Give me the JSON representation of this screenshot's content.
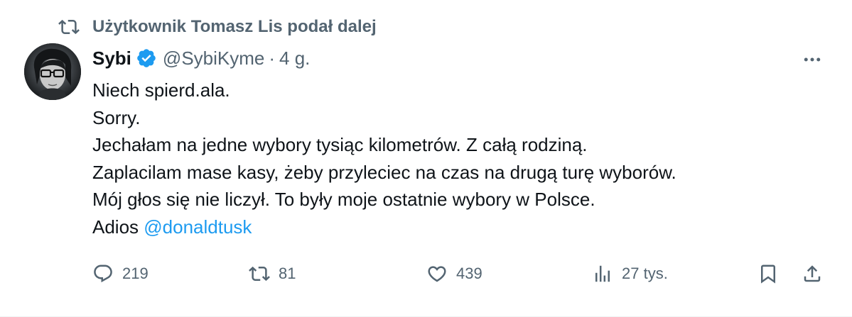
{
  "retweet": {
    "label": "Użytkownik Tomasz Lis podał dalej",
    "icon": "retweet-icon"
  },
  "author": {
    "name": "Sybi",
    "verified": true,
    "verified_color": "#1d9bf0",
    "handle": "@SybiKyme",
    "separator": "·",
    "time": "4 g."
  },
  "body": {
    "lines": [
      "Niech spierd.ala.",
      "Sorry.",
      "Jechałam na jedne wybory tysiąc kilometrów. Z całą rodziną.",
      "Zaplacilam mase kasy, żeby przyleciec na czas na drugą turę wyborów.",
      "Mój głos się nie liczył. To były moje ostatnie wybory w Polsce."
    ],
    "last_line_prefix": "Adios ",
    "mention": "@donaldtusk"
  },
  "actions": {
    "replies": "219",
    "retweets": "81",
    "likes": "439",
    "views": "27 tys."
  },
  "colors": {
    "text": "#0f1419",
    "secondary": "#536471",
    "link": "#1d9bf0"
  }
}
